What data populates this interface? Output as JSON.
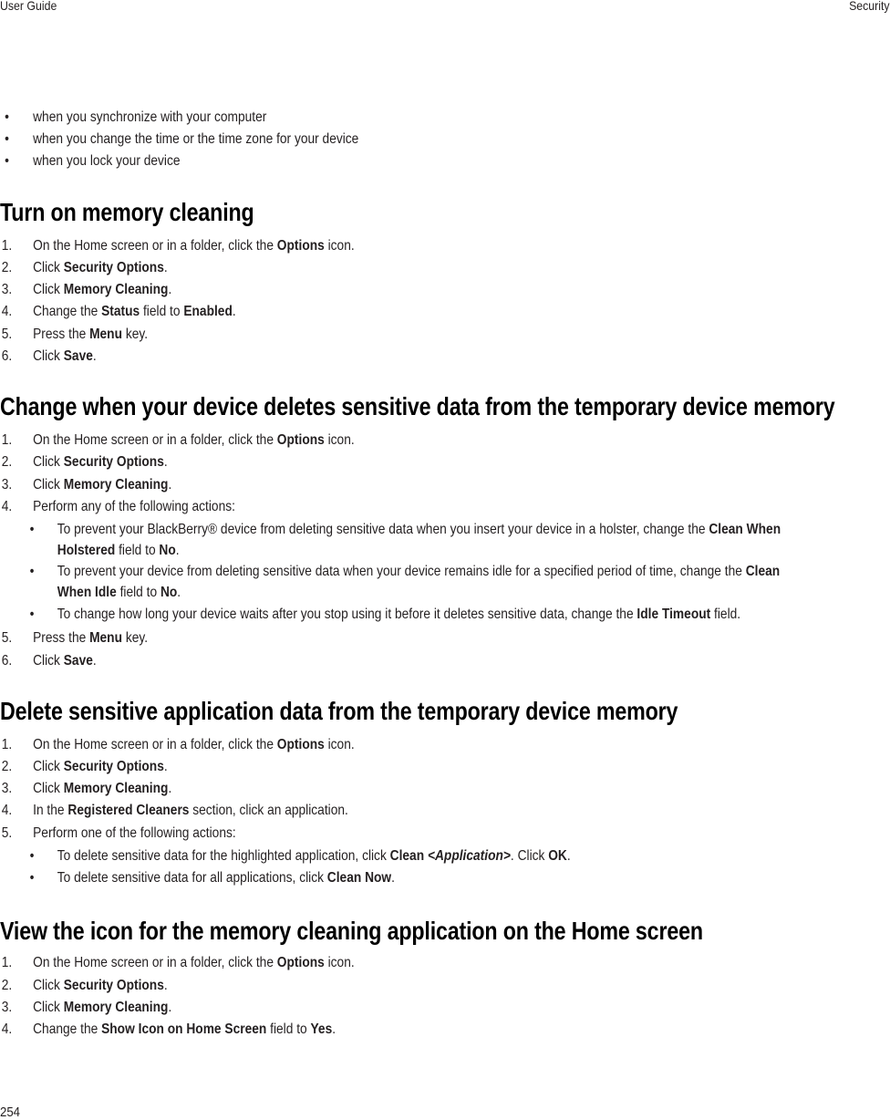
{
  "header": {
    "left": "User Guide",
    "right": "Security"
  },
  "footer": {
    "page_number": "254"
  },
  "intro_bullets": [
    "when you synchronize with your computer",
    "when you change the time or the time zone for your device",
    "when you lock your device"
  ],
  "sections": [
    {
      "title": "Turn on memory cleaning",
      "steps": [
        {
          "n": "1.",
          "pre": "On the Home screen or in a folder, click the ",
          "bold": "Options",
          "post": " icon."
        },
        {
          "n": "2.",
          "pre": "Click ",
          "bold": "Security Options",
          "post": "."
        },
        {
          "n": "3.",
          "pre": "Click ",
          "bold": "Memory Cleaning",
          "post": "."
        },
        {
          "n": "4.",
          "pre": "Change the ",
          "bold": "Status",
          "mid": " field to ",
          "bold2": "Enabled",
          "post": "."
        },
        {
          "n": "5.",
          "pre": "Press the ",
          "bold": "Menu",
          "post": " key."
        },
        {
          "n": "6.",
          "pre": "Click ",
          "bold": "Save",
          "post": "."
        }
      ]
    },
    {
      "title": "Change when your device deletes sensitive data from the temporary device memory",
      "steps": [
        {
          "n": "1.",
          "pre": "On the Home screen or in a folder, click the ",
          "bold": "Options",
          "post": " icon."
        },
        {
          "n": "2.",
          "pre": "Click ",
          "bold": "Security Options",
          "post": "."
        },
        {
          "n": "3.",
          "pre": "Click ",
          "bold": "Memory Cleaning",
          "post": "."
        },
        {
          "n": "4.",
          "pre": "Perform any of the following actions:"
        },
        {
          "n": "5.",
          "pre": "Press the ",
          "bold": "Menu",
          "post": " key."
        },
        {
          "n": "6.",
          "pre": "Click ",
          "bold": "Save",
          "post": "."
        }
      ],
      "sub_bullets": [
        {
          "l1_pre": "To prevent your BlackBerry® device from deleting sensitive data when you insert your device in a holster, change the ",
          "l1_bold": "Clean When",
          "l2_bold": "Holstered",
          "l2_mid": " field to ",
          "l2_bold2": "No",
          "l2_post": "."
        },
        {
          "l1_pre": "To prevent your device from deleting sensitive data when your device remains idle for a specified period of time, change the ",
          "l1_bold": "Clean",
          "l2_bold": "When Idle",
          "l2_mid": " field to ",
          "l2_bold2": "No",
          "l2_post": "."
        },
        {
          "l1_pre": "To change how long your device waits after you stop using it before it deletes sensitive data, change the ",
          "l1_bold": "Idle Timeout",
          "l1_post": " field."
        }
      ]
    },
    {
      "title": "Delete sensitive application data from the temporary device memory",
      "steps": [
        {
          "n": "1.",
          "pre": "On the Home screen or in a folder, click the ",
          "bold": "Options",
          "post": " icon."
        },
        {
          "n": "2.",
          "pre": "Click ",
          "bold": "Security Options",
          "post": "."
        },
        {
          "n": "3.",
          "pre": "Click ",
          "bold": "Memory Cleaning",
          "post": "."
        },
        {
          "n": "4.",
          "pre": "In the ",
          "bold": "Registered Cleaners",
          "post": " section, click an application."
        },
        {
          "n": "5.",
          "pre": "Perform one of the following actions:"
        }
      ],
      "sub_bullets": [
        {
          "pre": "To delete sensitive data for the highlighted application, click ",
          "bold": "Clean ",
          "italic": "<Application>",
          "mid": ". Click ",
          "bold2": "OK",
          "post": "."
        },
        {
          "pre": "To delete sensitive data for all applications, click ",
          "bold": "Clean Now",
          "post": "."
        }
      ]
    },
    {
      "title": "View the icon for the memory cleaning application on the Home screen",
      "steps": [
        {
          "n": "1.",
          "pre": "On the Home screen or in a folder, click the ",
          "bold": "Options",
          "post": " icon."
        },
        {
          "n": "2.",
          "pre": "Click ",
          "bold": "Security Options",
          "post": "."
        },
        {
          "n": "3.",
          "pre": "Click ",
          "bold": "Memory Cleaning",
          "post": "."
        },
        {
          "n": "4.",
          "pre": "Change the ",
          "bold": "Show Icon on Home Screen",
          "mid": " field to ",
          "bold2": "Yes",
          "post": "."
        }
      ]
    }
  ],
  "bullet_glyph": "•"
}
